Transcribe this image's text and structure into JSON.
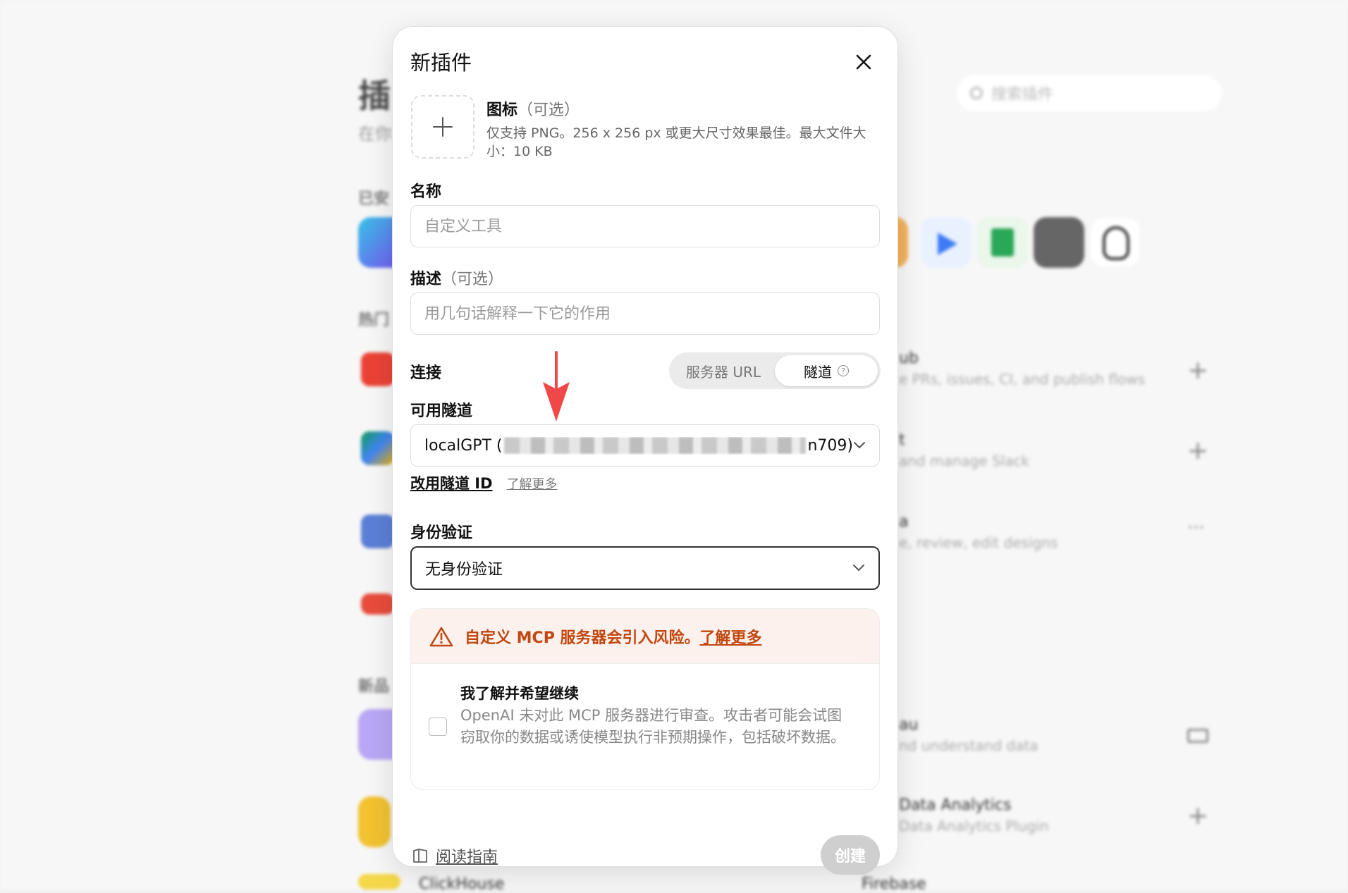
{
  "background": {
    "page_title": "插",
    "page_subtitle": "在你",
    "search_placeholder": "搜索插件",
    "section_installed": "已安",
    "section_popular": "热门",
    "section_new": "新品",
    "rows": [
      {
        "title": "ub",
        "desc": "e PRs, issues, CI, and publish flows"
      },
      {
        "title": "t",
        "desc": "and manage Slack"
      },
      {
        "title": "a",
        "desc": "e, review, edit designs"
      },
      {
        "title": "au",
        "desc": "nd understand data"
      },
      {
        "title": "Data Analytics",
        "desc": "Data Analytics Plugin"
      },
      {
        "title": "Firebase",
        "desc": ""
      },
      {
        "title": "ClickHouse",
        "desc": ""
      }
    ],
    "more_glyph": "···"
  },
  "modal": {
    "title": "新插件",
    "icon_section": {
      "label": "图标",
      "optional": "（可选）",
      "hint": "仅支持 PNG。256 x 256 px 或更大尺寸效果最佳。最大文件大小：10 KB"
    },
    "name": {
      "label": "名称",
      "placeholder": "自定义工具"
    },
    "description": {
      "label": "描述",
      "optional": "（可选）",
      "placeholder": "用几句话解释一下它的作用"
    },
    "connection": {
      "label": "连接",
      "options": [
        "服务器 URL",
        "隧道"
      ],
      "selected": "隧道"
    },
    "tunnel": {
      "label": "可用隧道",
      "value_prefix": "localGPT (",
      "value_suffix": "n709)",
      "use_id_link": "改用隧道 ID",
      "learn_more": "了解更多"
    },
    "auth": {
      "label": "身份验证",
      "value": "无身份验证"
    },
    "warning": {
      "text": "自定义 MCP 服务器会引入风险。",
      "link": "了解更多",
      "ack_title": "我了解并希望继续",
      "ack_desc": "OpenAI 未对此 MCP 服务器进行审查。攻击者可能会试图窃取你的数据或诱使模型执行非预期操作，包括破坏数据。",
      "checked": false
    },
    "footer": {
      "guide": "阅读指南",
      "create": "创建"
    }
  },
  "colors": {
    "warning": "#c1470f",
    "annotation_arrow": "#f04848"
  }
}
